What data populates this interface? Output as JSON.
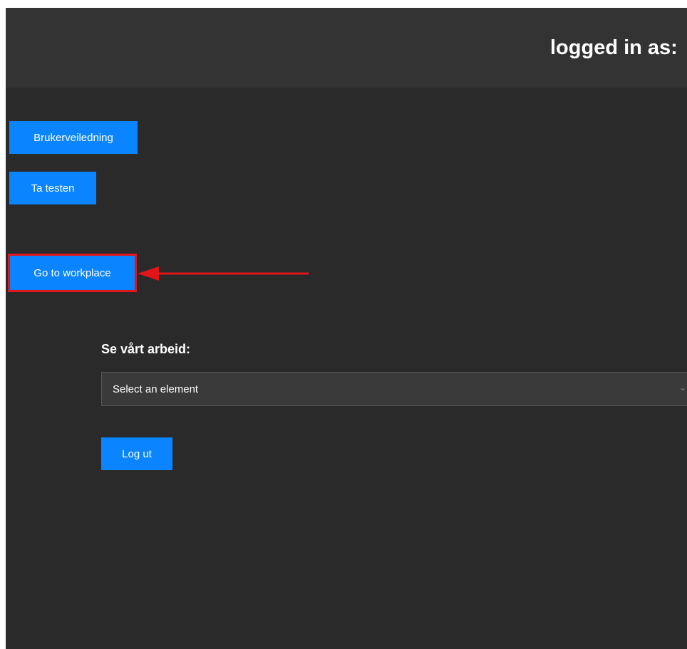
{
  "header": {
    "title": "logged in as:"
  },
  "nav": {
    "guide_label": "Brukerveiledning",
    "test_label": "Ta testen",
    "workplace_label": "Go to workplace"
  },
  "work": {
    "section_label": "Se vårt arbeid:",
    "select_value": "Select an element",
    "select_icon": "chevron-down-icon"
  },
  "actions": {
    "logout_label": "Log ut"
  },
  "annotation": {
    "arrow_icon": "red-arrow-left-icon",
    "highlight_color": "#e0161b"
  },
  "colors": {
    "background": "#2a2a2a",
    "header": "#333333",
    "accent": "#0a84ff"
  }
}
